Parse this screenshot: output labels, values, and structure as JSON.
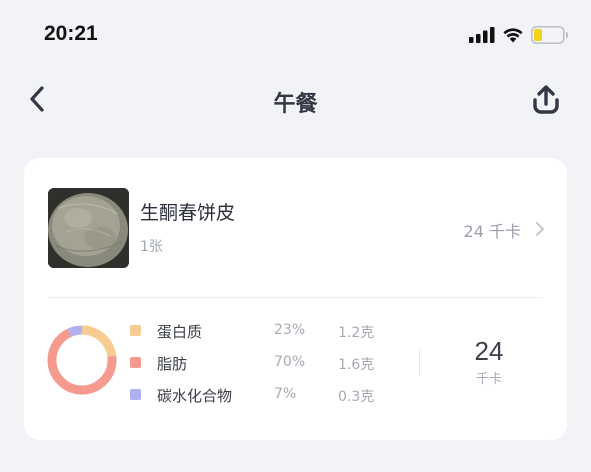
{
  "status_bar": {
    "time": "20:21"
  },
  "nav": {
    "title": "午餐"
  },
  "food": {
    "name": "生酮春饼皮",
    "quantity": "1张",
    "calories": "24 千卡"
  },
  "macros": [
    {
      "name": "蛋白质",
      "percent": "23%",
      "grams": "1.2克",
      "color": "#f7cc93",
      "fraction": 0.23
    },
    {
      "name": "脂肪",
      "percent": "70%",
      "grams": "1.6克",
      "color": "#f59a8f",
      "fraction": 0.7
    },
    {
      "name": "碳水化合物",
      "percent": "7%",
      "grams": "0.3克",
      "color": "#aeb0f0",
      "fraction": 0.07
    }
  ],
  "total": {
    "value": "24",
    "unit": "千卡"
  }
}
